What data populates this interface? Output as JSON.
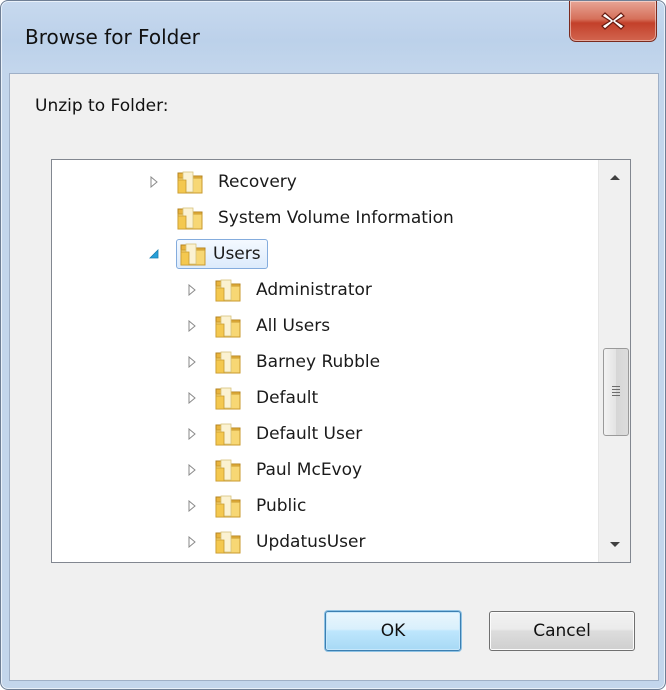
{
  "window": {
    "title": "Browse for Folder",
    "close_icon": "close-x-icon"
  },
  "dialog": {
    "prompt": "Unzip to Folder:"
  },
  "tree": {
    "items": [
      {
        "label": "Recovery",
        "level": 1,
        "expander": "collapsed",
        "selected": false
      },
      {
        "label": "System Volume Information",
        "level": 1,
        "expander": "none",
        "selected": false
      },
      {
        "label": "Users",
        "level": 1,
        "expander": "expanded",
        "selected": true
      },
      {
        "label": "Administrator",
        "level": 2,
        "expander": "collapsed",
        "selected": false
      },
      {
        "label": "All Users",
        "level": 2,
        "expander": "collapsed",
        "selected": false
      },
      {
        "label": "Barney Rubble",
        "level": 2,
        "expander": "collapsed",
        "selected": false
      },
      {
        "label": "Default",
        "level": 2,
        "expander": "collapsed",
        "selected": false
      },
      {
        "label": "Default User",
        "level": 2,
        "expander": "collapsed",
        "selected": false
      },
      {
        "label": "Paul McEvoy",
        "level": 2,
        "expander": "collapsed",
        "selected": false
      },
      {
        "label": "Public",
        "level": 2,
        "expander": "collapsed",
        "selected": false
      },
      {
        "label": "UpdatusUser",
        "level": 2,
        "expander": "collapsed",
        "selected": false
      }
    ],
    "scroll_position": 0.62
  },
  "buttons": {
    "ok_label": "OK",
    "cancel_label": "Cancel"
  },
  "colors": {
    "selection_border": "#84acdd",
    "selection_fill": "#dcebfc",
    "folder_yellow": "#f2c94c",
    "close_red": "#c3402a"
  }
}
